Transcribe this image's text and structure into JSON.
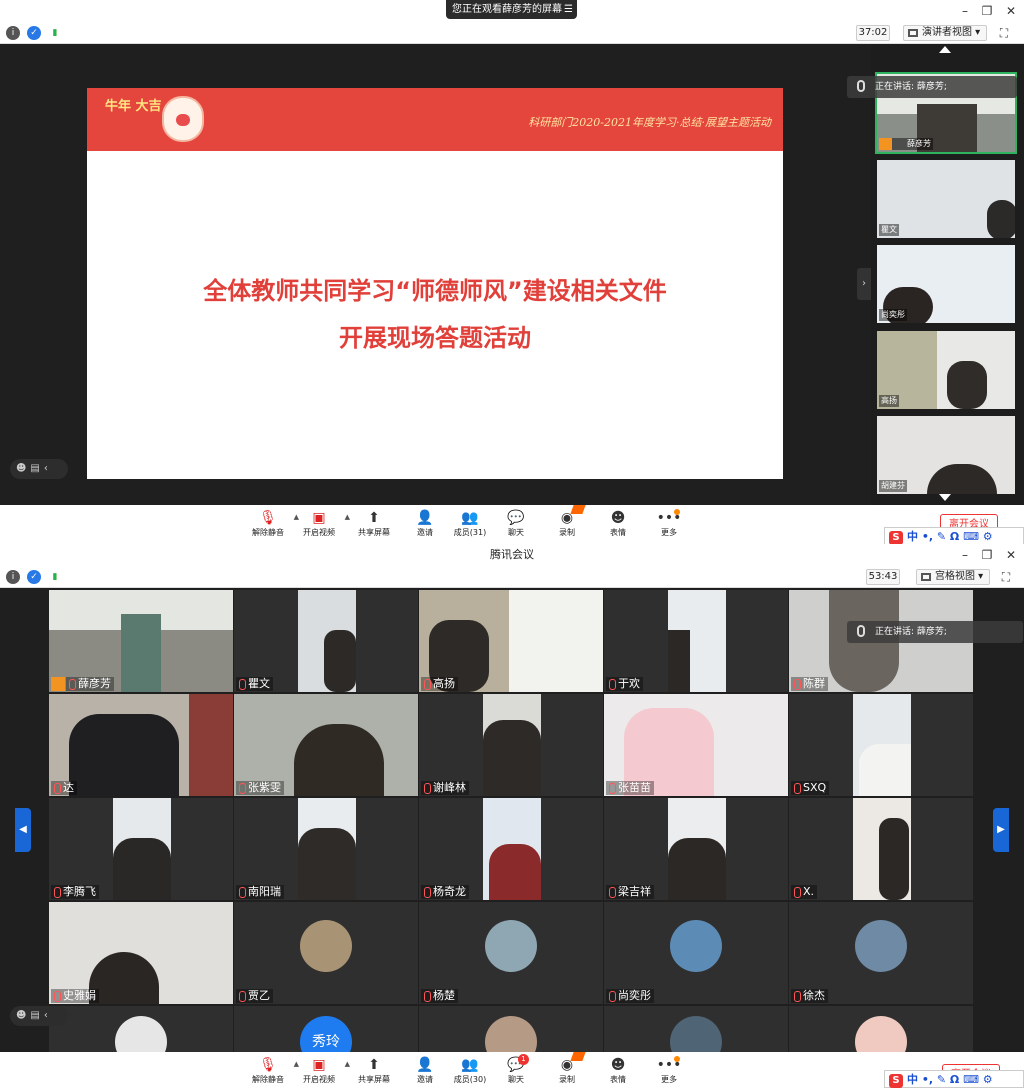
{
  "window1": {
    "banner": "您正在观看薛彦芳的屏幕",
    "timer": "37:02",
    "view_mode": "演讲者视图",
    "slide": {
      "logo": "牛年 大吉",
      "department_line": "科研部门2020-2021年度学习·总结·展望主题活动",
      "line1": "全体教师共同学习“师德师风”建设相关文件",
      "line2": "开展现场答题活动"
    },
    "speaking": "正在讲话: 薛彦芳;",
    "thumbnails": [
      {
        "name": "薛彦芳"
      },
      {
        "name": "瞿文"
      },
      {
        "name": "尚奕彤"
      },
      {
        "name": "高扬"
      },
      {
        "name": "胡建芬"
      }
    ],
    "toolbar": {
      "unmute": "解除静音",
      "start_video": "开启视频",
      "share": "共享屏幕",
      "invite": "邀请",
      "members": "成员(31)",
      "chat": "聊天",
      "record": "录制",
      "reactions": "表情",
      "more": "更多",
      "leave": "离开会议"
    }
  },
  "window2": {
    "title": "腾讯会议",
    "timer": "53:43",
    "view_mode": "宫格视图",
    "speaking": "正在讲话: 薛彦芳;",
    "participants": [
      {
        "name": "薛彦芳",
        "kind": "video"
      },
      {
        "name": "瞿文",
        "kind": "video"
      },
      {
        "name": "高扬",
        "kind": "video"
      },
      {
        "name": "于欢",
        "kind": "video"
      },
      {
        "name": "陈群",
        "kind": "video"
      },
      {
        "name": "达",
        "kind": "video"
      },
      {
        "name": "张紫雯",
        "kind": "video"
      },
      {
        "name": "谢峰林",
        "kind": "video"
      },
      {
        "name": "张苗苗",
        "kind": "video"
      },
      {
        "name": "SXQ",
        "kind": "video"
      },
      {
        "name": "李腾飞",
        "kind": "video"
      },
      {
        "name": "南阳瑞",
        "kind": "video"
      },
      {
        "name": "杨奇龙",
        "kind": "video"
      },
      {
        "name": "梁吉祥",
        "kind": "video"
      },
      {
        "name": "X.",
        "kind": "video"
      },
      {
        "name": "史雅娟",
        "kind": "video"
      },
      {
        "name": "贾乙",
        "kind": "avatar"
      },
      {
        "name": "杨楚",
        "kind": "avatar"
      },
      {
        "name": "尚奕彤",
        "kind": "avatar"
      },
      {
        "name": "徐杰",
        "kind": "avatar"
      },
      {
        "name": "",
        "kind": "avatar"
      },
      {
        "name": "",
        "kind": "text-avatar",
        "avatar_text": "秀玲"
      },
      {
        "name": "",
        "kind": "avatar"
      },
      {
        "name": "",
        "kind": "avatar"
      },
      {
        "name": "",
        "kind": "avatar"
      }
    ],
    "toolbar": {
      "unmute": "解除静音",
      "start_video": "开启视频",
      "share": "共享屏幕",
      "invite": "邀请",
      "members": "成员(30)",
      "chat": "聊天",
      "chat_badge": "1",
      "record": "录制",
      "reactions": "表情",
      "more": "更多",
      "leave": "离开会议"
    }
  },
  "ime": {
    "lang": "中"
  },
  "colors": {
    "accent": "#1966d6",
    "slide_red": "#e4463e",
    "leave": "#e33333"
  }
}
